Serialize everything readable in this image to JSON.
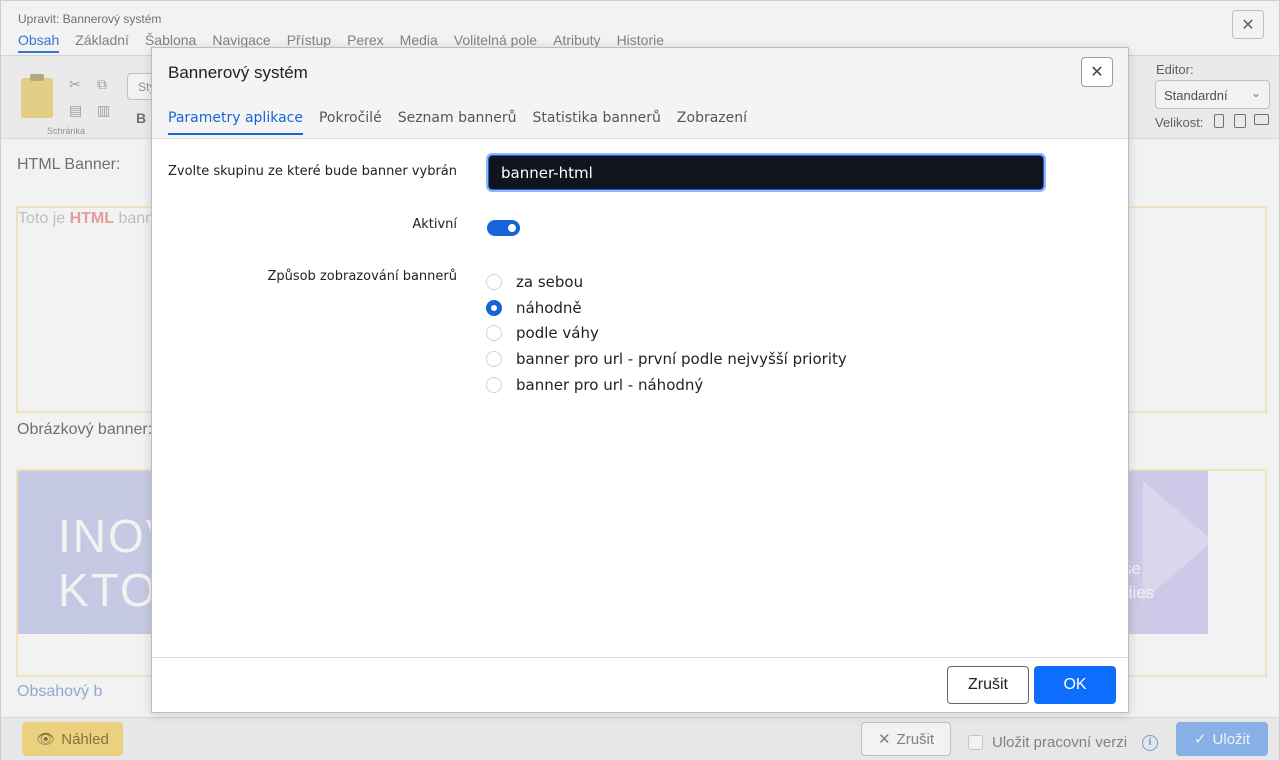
{
  "background": {
    "window_title": "Upravit: Bannerový systém",
    "tabs": [
      {
        "label": "Obsah",
        "active": true
      },
      {
        "label": "Základní"
      },
      {
        "label": "Šablona"
      },
      {
        "label": "Navigace"
      },
      {
        "label": "Přístup"
      },
      {
        "label": "Perex"
      },
      {
        "label": "Media"
      },
      {
        "label": "Volitelná pole"
      },
      {
        "label": "Atributy"
      },
      {
        "label": "Historie"
      }
    ],
    "toolbar": {
      "clipboard_label": "Schránka",
      "style_placeholder": "Sty",
      "bold_label": "B",
      "editor_label": "Editor:",
      "editor_value": "Standardní",
      "size_label": "Velikost:"
    },
    "content": {
      "html_banner_label": "HTML Banner:",
      "html_banner_text_prefix": "Toto je ",
      "html_banner_text_bold": "HTML",
      "html_banner_text_suffix": " bann",
      "image_banner_label": "Obrázkový banner:",
      "image_banner_line1": "INOV",
      "image_banner_line2": "KTOR",
      "image_banner_right1": "se",
      "image_banner_right2": "dies",
      "bottom_partial_label": "Obsahový b"
    },
    "footer": {
      "preview_label": "Náhled",
      "cancel_label": "Zrušit",
      "checkbox_label": "Uložit pracovní verzi",
      "info_icon": "i",
      "save_label": "Uložit"
    },
    "colors": {
      "preview_bg": "#f7dc86",
      "save_bg": "#8fbbf3"
    }
  },
  "modal": {
    "title": "Bannerový systém",
    "tabs": [
      {
        "label": "Parametry aplikace",
        "active": true
      },
      {
        "label": "Pokročilé"
      },
      {
        "label": "Seznam bannerů"
      },
      {
        "label": "Statistika bannerů"
      },
      {
        "label": "Zobrazení"
      }
    ],
    "fields": {
      "group_label": "Zvolte skupinu ze které bude banner vybrán",
      "group_value": "banner-html",
      "active_label": "Aktivní",
      "active_value": true,
      "display_mode_label": "Způsob zobrazování bannerů",
      "display_mode_options": [
        {
          "label": "za sebou",
          "checked": false
        },
        {
          "label": "náhodně",
          "checked": true
        },
        {
          "label": "podle váhy",
          "checked": false
        },
        {
          "label": "banner pro url - první podle nejvyšší priority",
          "checked": false
        },
        {
          "label": "banner pro url - náhodný",
          "checked": false
        }
      ]
    },
    "buttons": {
      "cancel": "Zrušit",
      "ok": "OK"
    },
    "colors": {
      "accent": "#0d6efd",
      "input_bg": "#11141c"
    }
  }
}
